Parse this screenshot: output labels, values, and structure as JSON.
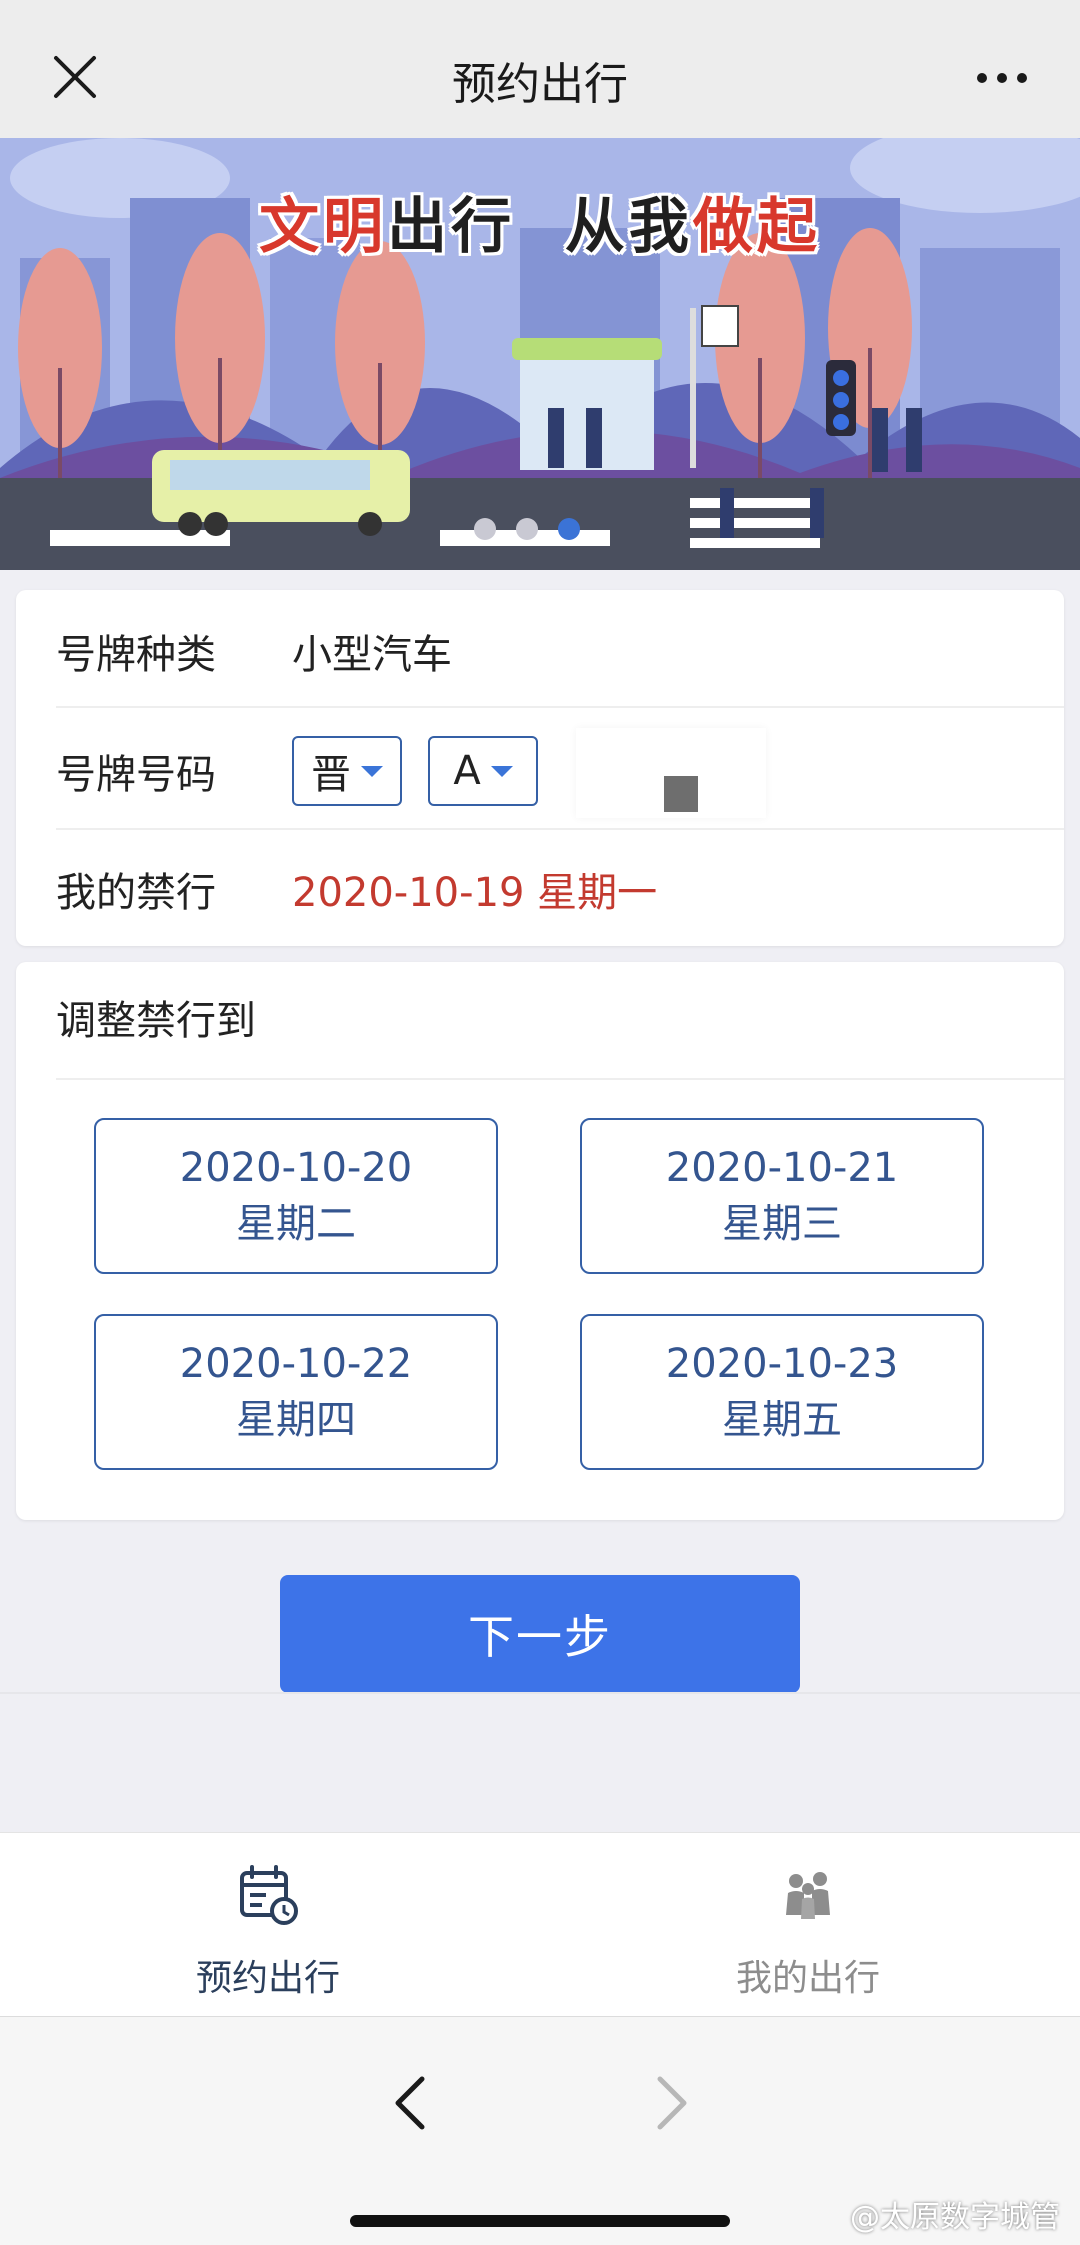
{
  "topbar": {
    "title": "预约出行",
    "close_icon": "close-icon",
    "more_icon": "more-icon"
  },
  "banner": {
    "slogan_part1": "文明",
    "slogan_part2": "出行",
    "slogan_part3": "从我",
    "slogan_part4": "做起",
    "slide_count": 3,
    "active_slide": 3
  },
  "plate": {
    "type_label": "号牌种类",
    "type_value": "小型汽车",
    "number_label": "号牌号码",
    "province": "晋",
    "letter": "A",
    "ban_label": "我的禁行",
    "ban_value": "2020-10-19 星期一"
  },
  "adjust": {
    "title": "调整禁行到",
    "options": [
      {
        "date": "2020-10-20",
        "weekday": "星期二"
      },
      {
        "date": "2020-10-21",
        "weekday": "星期三"
      },
      {
        "date": "2020-10-22",
        "weekday": "星期四"
      },
      {
        "date": "2020-10-23",
        "weekday": "星期五"
      }
    ]
  },
  "next_button": "下一步",
  "tabbar": {
    "tab1": {
      "label": "预约出行",
      "icon": "calendar-clock-icon"
    },
    "tab2": {
      "label": "我的出行",
      "icon": "people-icon"
    }
  },
  "browser": {
    "back_icon": "chevron-left-icon",
    "forward_icon": "chevron-right-icon"
  },
  "watermark": "@太原数字城管",
  "colors": {
    "accent": "#3d73e8",
    "border_blue": "#3560a6",
    "ban_red": "#c33a2f"
  }
}
